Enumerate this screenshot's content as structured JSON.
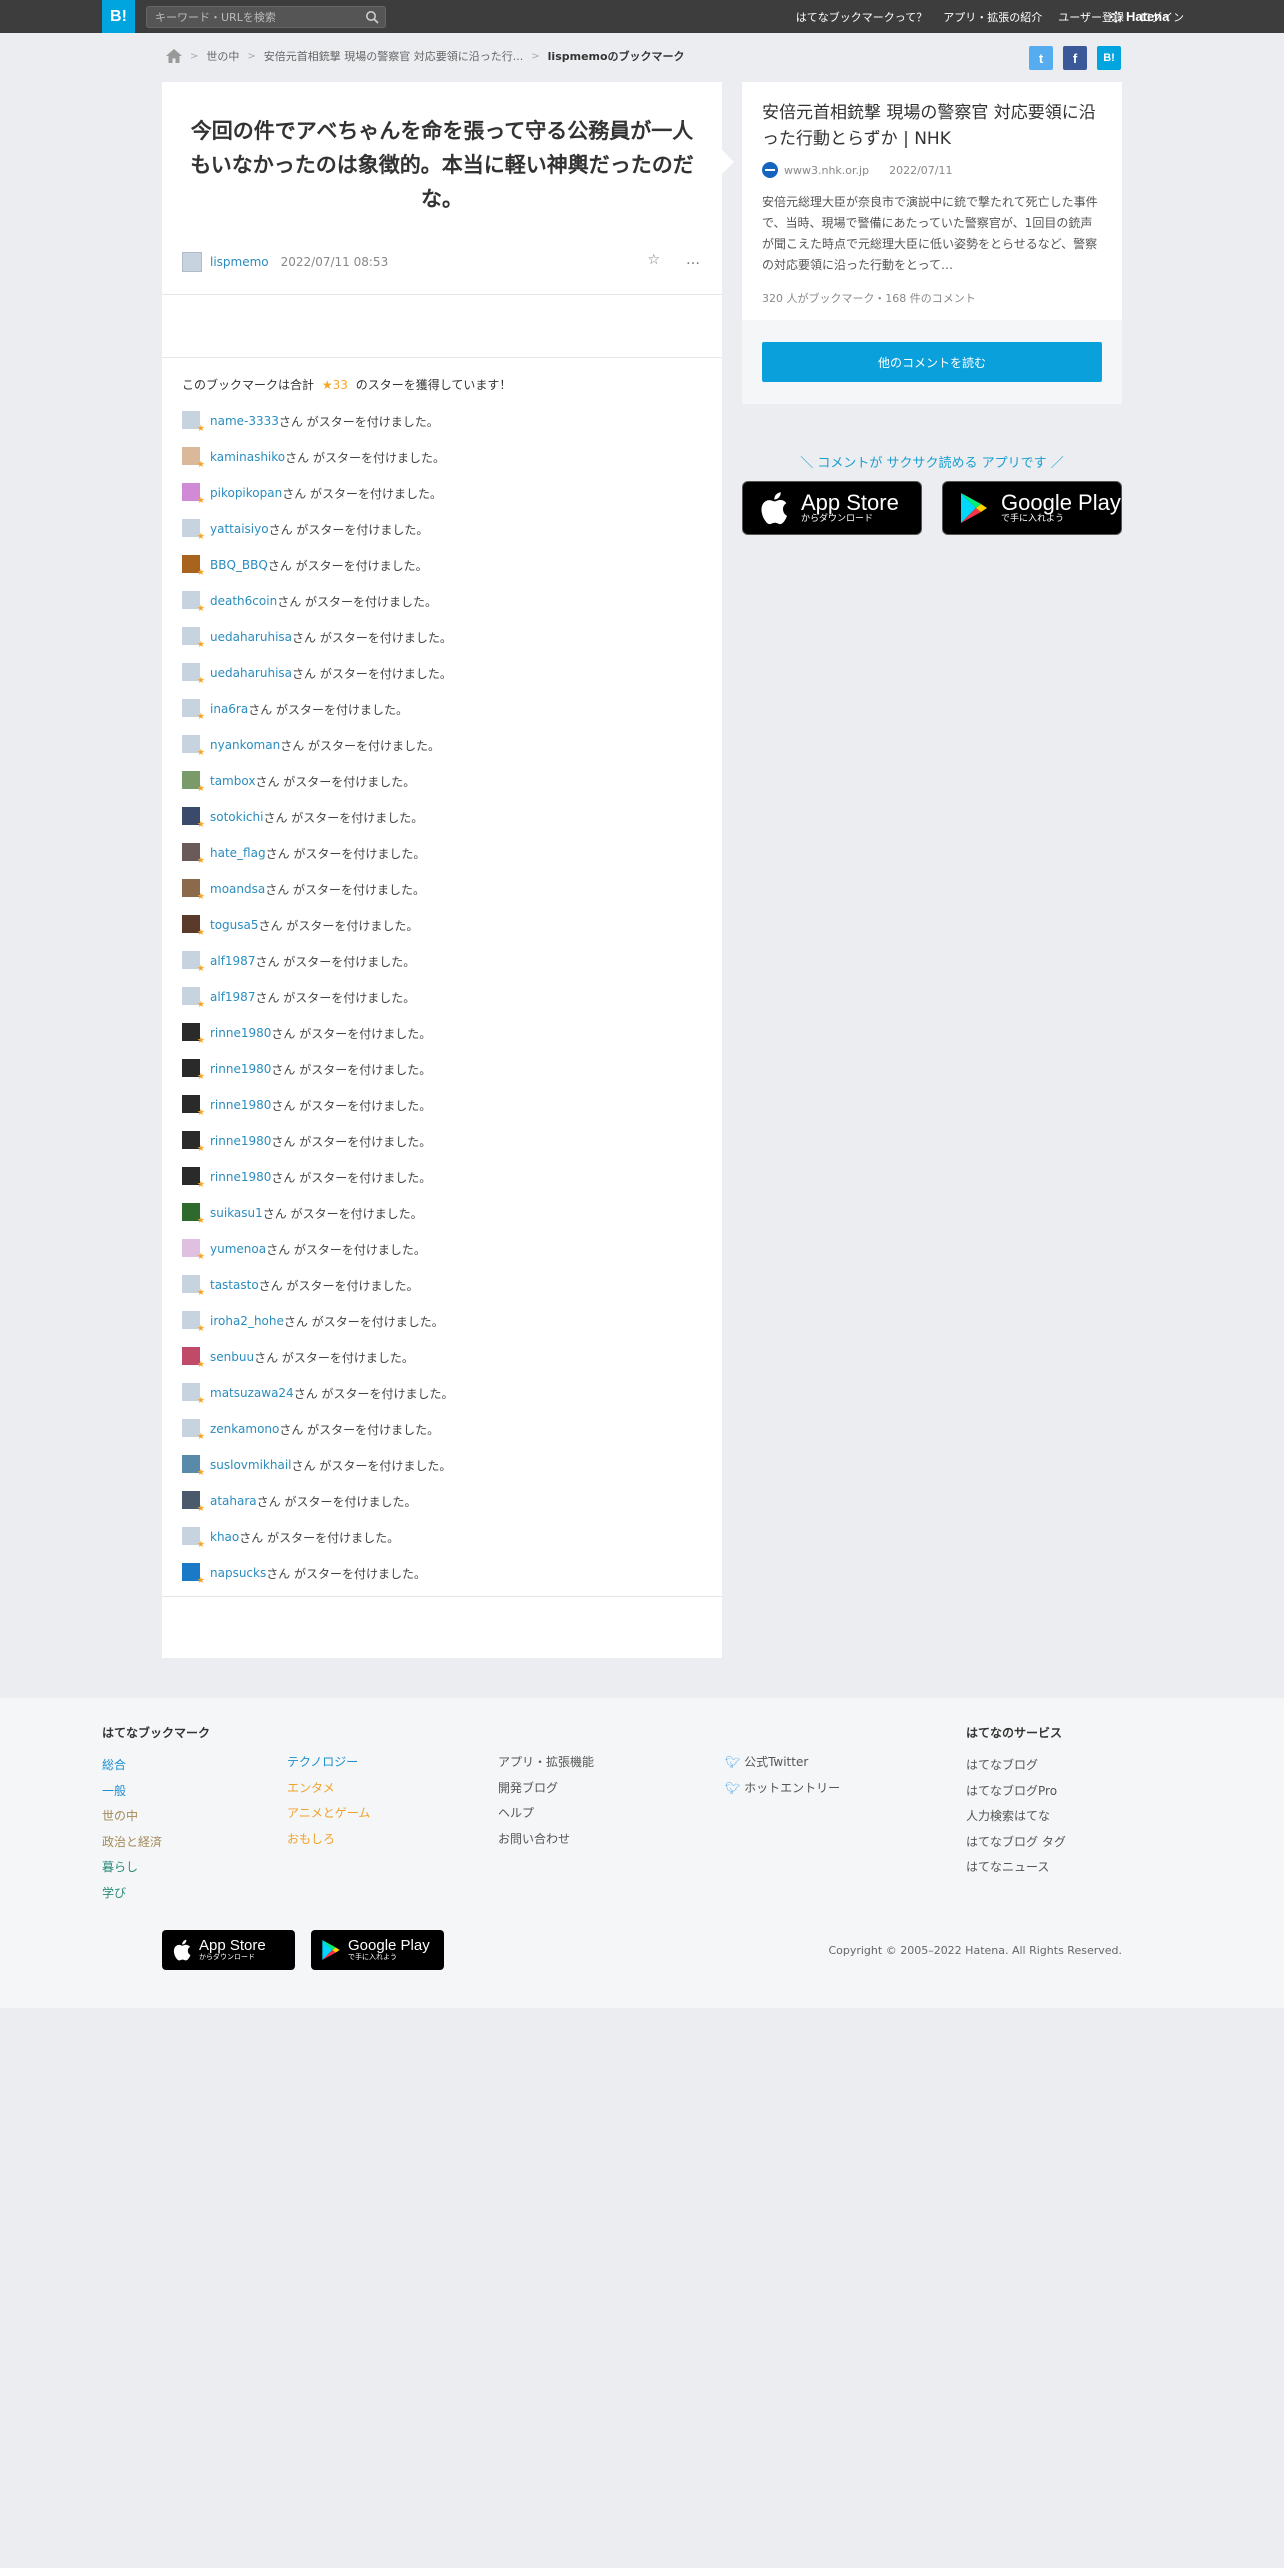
{
  "header": {
    "logo": "B!",
    "search_placeholder": "キーワード・URLを検索",
    "nav": [
      "はてなブックマークって？",
      "アプリ・拡張の紹介",
      "ユーザー登録",
      "ログイン"
    ],
    "brand": "Hatena"
  },
  "breadcrumb": {
    "items": [
      "世の中",
      "安倍元首相銃撃 現場の警察官 対応要領に沿った行..."
    ],
    "current": "lispmemoのブックマーク"
  },
  "share": {
    "twitter": "t",
    "facebook": "f",
    "hatena": "B!"
  },
  "bookmark": {
    "comment": "今回の件でアベちゃんを命を張って守る公務員が一人もいなかったのは象徴的。本当に軽い神輿だったのだな。",
    "user": "lispmemo",
    "date": "2022/07/11 08:53",
    "add_star_icon": "☆",
    "more_icon": "…"
  },
  "stars": {
    "prefix": "このブックマークは合計",
    "count": "★33",
    "suffix": "のスターを獲得しています！",
    "row_suffix": "さん がスターを付けました。",
    "users": [
      {
        "name": "name-3333",
        "color": "#c8d3e0"
      },
      {
        "name": "kaminashiko",
        "color": "#d9b99a"
      },
      {
        "name": "pikopikopan",
        "color": "#d08ad6"
      },
      {
        "name": "yattaisiyo",
        "color": "#c8d3e0"
      },
      {
        "name": "BBQ_BBQ",
        "color": "#a8641e"
      },
      {
        "name": "death6coin",
        "color": "#c8d3e0"
      },
      {
        "name": "uedaharuhisa",
        "color": "#c8d3e0"
      },
      {
        "name": "uedaharuhisa",
        "color": "#c8d3e0"
      },
      {
        "name": "ina6ra",
        "color": "#c8d3e0"
      },
      {
        "name": "nyankoman",
        "color": "#c8d3e0"
      },
      {
        "name": "tambox",
        "color": "#7a9a6a"
      },
      {
        "name": "sotokichi",
        "color": "#3a4a6a"
      },
      {
        "name": "hate_flag",
        "color": "#6a5a5a"
      },
      {
        "name": "moandsa",
        "color": "#8a6a4a"
      },
      {
        "name": "togusa5",
        "color": "#5a3a2a"
      },
      {
        "name": "alf1987",
        "color": "#c8d3e0"
      },
      {
        "name": "alf1987",
        "color": "#c8d3e0"
      },
      {
        "name": "rinne1980",
        "color": "#2a2a2a"
      },
      {
        "name": "rinne1980",
        "color": "#2a2a2a"
      },
      {
        "name": "rinne1980",
        "color": "#2a2a2a"
      },
      {
        "name": "rinne1980",
        "color": "#2a2a2a"
      },
      {
        "name": "rinne1980",
        "color": "#2a2a2a"
      },
      {
        "name": "suikasu1",
        "color": "#2e6a2e"
      },
      {
        "name": "yumenoa",
        "color": "#e0c0e0"
      },
      {
        "name": "tastasto",
        "color": "#c8d3e0"
      },
      {
        "name": "iroha2_hohe",
        "color": "#c8d3e0"
      },
      {
        "name": "senbuu",
        "color": "#c04a6a"
      },
      {
        "name": "matsuzawa24",
        "color": "#c8d3e0"
      },
      {
        "name": "zenkamono",
        "color": "#c8d3e0"
      },
      {
        "name": "suslovmikhail",
        "color": "#5a8aaa"
      },
      {
        "name": "atahara",
        "color": "#4a5a6a"
      },
      {
        "name": "khao",
        "color": "#c8d3e0"
      },
      {
        "name": "napsucks",
        "color": "#1a7ac8"
      }
    ]
  },
  "entry": {
    "title": "安倍元首相銃撃 現場の警察官 対応要領に沿った行動とらずか | NHK",
    "site": "www3.nhk.or.jp",
    "date": "2022/07/11",
    "body": "安倍元総理大臣が奈良市で演説中に銃で撃たれて死亡した事件で、当時、現場で警備にあたっていた警察官が、1回目の銃声が聞こえた時点で元総理大臣に低い姿勢をとらせるなど、警察の対応要領に沿った行動をとって…",
    "counts": "320 人がブックマーク・168 件のコメント",
    "read_button": "他のコメントを読む"
  },
  "promo": {
    "text": "＼ コメントが サクサク読める アプリです ／",
    "appstore_big": "App Store",
    "appstore_small": "からダウンロード",
    "googleplay_big": "Google Play",
    "googleplay_small": "で手に入れよう"
  },
  "footer": {
    "col1_head": "はてなブックマーク",
    "col1": [
      "総合",
      "一般",
      "世の中",
      "政治と経済",
      "暮らし",
      "学び"
    ],
    "col2": [
      "テクノロジー",
      "エンタメ",
      "アニメとゲーム",
      "おもしろ"
    ],
    "col3": [
      "アプリ・拡張機能",
      "開発ブログ",
      "ヘルプ",
      "お問い合わせ"
    ],
    "col4": [
      "公式Twitter",
      "ホットエントリー"
    ],
    "col5_head": "はてなのサービス",
    "col5": [
      "はてなブログ",
      "はてなブログPro",
      "人力検索はてな",
      "はてなブログ タグ",
      "はてなニュース"
    ],
    "copyright": "Copyright © 2005–2022 Hatena. All Rights Reserved."
  }
}
